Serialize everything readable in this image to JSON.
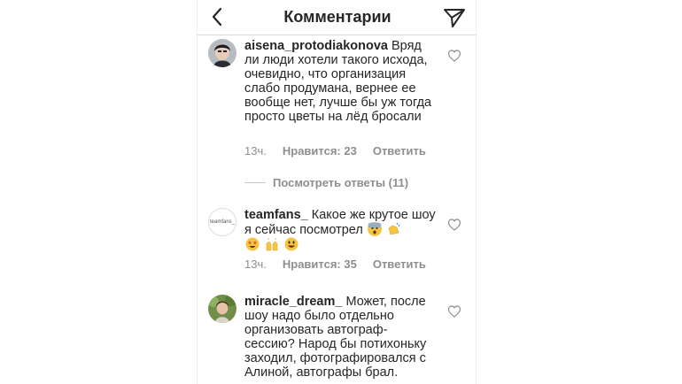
{
  "header": {
    "title": "Комментарии",
    "back_icon": "chevron-left-icon",
    "send_icon": "paper-plane-icon"
  },
  "comments": [
    {
      "username": "aisena_protodiakonova",
      "text": "Вряд ли люди хотели такого исхода, очевидно, что организация слабо продумана, вернее ее вообще нет, лучше бы уж тогда просто цветы на лёд бросали",
      "time": "13ч.",
      "likes": "Нравится: 23",
      "reply": "Ответить",
      "view_replies": "Посмотреть ответы (11)"
    },
    {
      "username": "teamfans_",
      "avatar_text": "teamfans_",
      "text": "Какое же крутое шоу я сейчас посмотрел",
      "emojis": [
        "scream-emoji",
        "clap-emoji",
        "star-struck-emoji",
        "raised-hands-emoji",
        "smiley-emoji"
      ],
      "time": "13ч.",
      "likes": "Нравится: 35",
      "reply": "Ответить"
    },
    {
      "username": "miracle_dream_",
      "text": "Может, после шоу надо было отдельно организовать автограф-сессию? Народ бы потихоньку заходил, фотографировался с Алиной, автографы брал."
    }
  ],
  "colors": {
    "text": "#262626",
    "meta": "#8e8e8e",
    "divider": "#dbdbdb"
  }
}
